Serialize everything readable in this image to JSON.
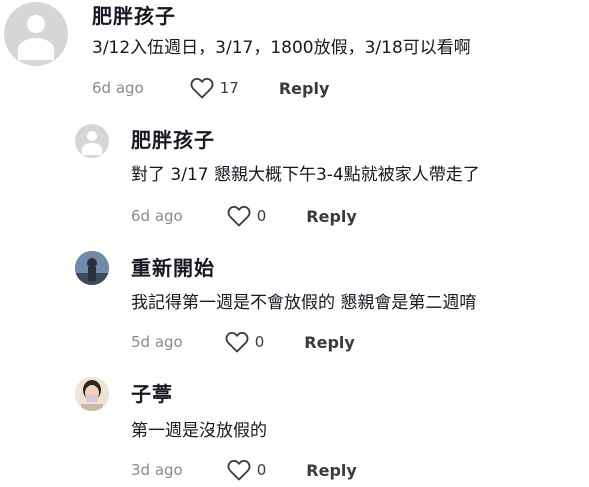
{
  "comments": [
    {
      "username": "肥胖孩子",
      "text": "3/12入伍週日，3/17，1800放假，3/18可以看啊",
      "date": "6d ago",
      "likes": "17",
      "reply_label": "Reply",
      "avatar_icon": "default-avatar-icon"
    },
    {
      "username": "肥胖孩子",
      "text": "對了 3/17 懇親大概下午3-4點就被家人帶走了",
      "date": "6d ago",
      "likes": "0",
      "reply_label": "Reply",
      "avatar_icon": "default-avatar-icon"
    },
    {
      "username": "重新開始",
      "text": "我記得第一週是不會放假的 懇親會是第二週唷",
      "date": "5d ago",
      "likes": "0",
      "reply_label": "Reply",
      "avatar_icon": "photo-avatar-icon"
    },
    {
      "username": "子葶",
      "text": "第一週是沒放假的",
      "date": "3d ago",
      "likes": "0",
      "reply_label": "Reply",
      "avatar_icon": "photo-avatar-icon"
    }
  ],
  "colors": {
    "text_primary": "#161823",
    "text_secondary": "#8a8b91",
    "avatar_default_bg": "#d6d6d8"
  }
}
